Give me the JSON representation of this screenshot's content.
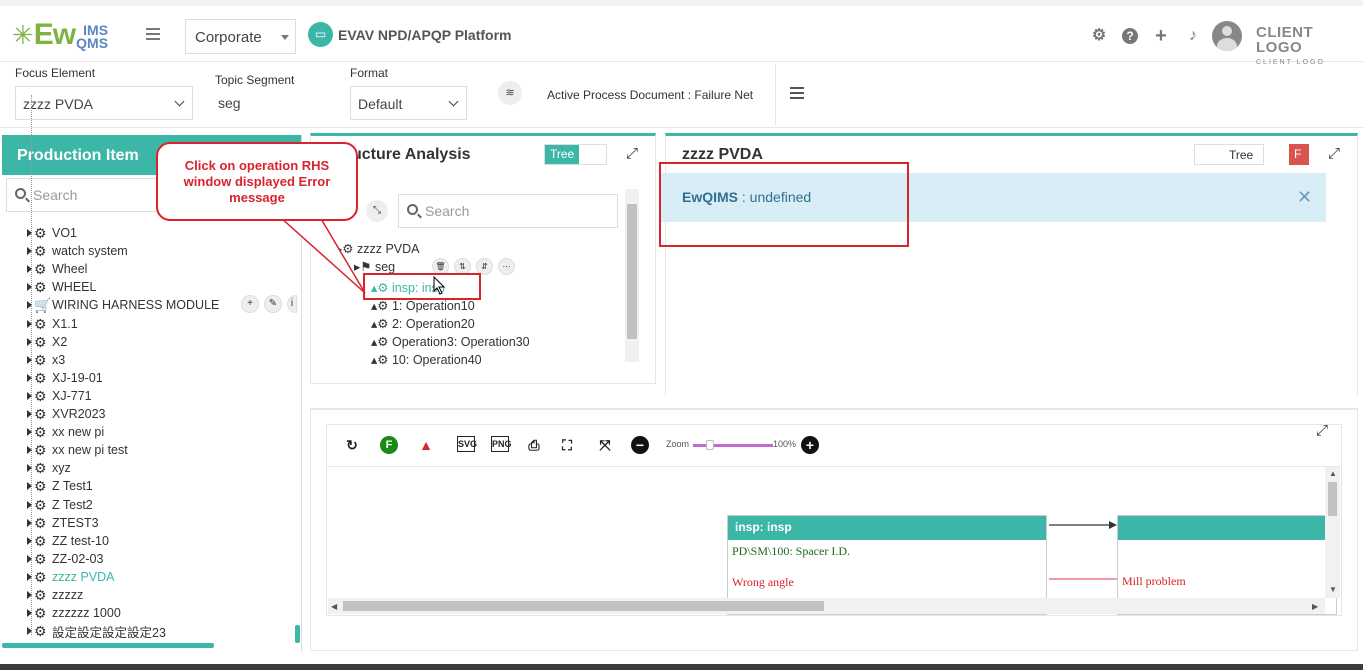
{
  "header": {
    "logo_main": "Ew",
    "logo_top": "IMS",
    "logo_bottom": "QMS",
    "corporate_select": "Corporate",
    "platform_title": "EVAV NPD/APQP Platform",
    "client_logo": "CLIENT LOGO",
    "client_logo_sub": "CLIENT LOGO"
  },
  "filters": {
    "focus_label": "Focus Element",
    "focus_value": "zzzz PVDA",
    "topic_label": "Topic Segment",
    "topic_value": "seg",
    "format_label": "Format",
    "format_value": "Default",
    "active_doc": "Active Process Document : Failure Net"
  },
  "left_panel": {
    "title": "Production Item",
    "search_placeholder": "Search",
    "items": [
      {
        "label": "VO1",
        "icon": "gear-icon"
      },
      {
        "label": "watch system",
        "icon": "gear-icon"
      },
      {
        "label": "Wheel",
        "icon": "gear-icon"
      },
      {
        "label": "WHEEL",
        "icon": "gear-icon"
      },
      {
        "label": "WIRING HARNESS MODULE",
        "icon": "cart-icon"
      },
      {
        "label": "X1.1",
        "icon": "gear-icon"
      },
      {
        "label": "X2",
        "icon": "gear-icon"
      },
      {
        "label": "x3",
        "icon": "gear-icon"
      },
      {
        "label": "XJ-19-01",
        "icon": "gear-icon"
      },
      {
        "label": "XJ-771",
        "icon": "gear-icon"
      },
      {
        "label": "XVR2023",
        "icon": "gear-icon"
      },
      {
        "label": "xx new pi",
        "icon": "gear-icon"
      },
      {
        "label": "xx new pi test",
        "icon": "gear-icon"
      },
      {
        "label": "xyz",
        "icon": "gear-icon"
      },
      {
        "label": "Z Test1",
        "icon": "gear-icon"
      },
      {
        "label": "Z Test2",
        "icon": "gear-icon"
      },
      {
        "label": "ZTEST3",
        "icon": "gear-icon"
      },
      {
        "label": "ZZ test-10",
        "icon": "gear-icon"
      },
      {
        "label": "ZZ-02-03",
        "icon": "gear-icon"
      },
      {
        "label": "zzzz PVDA",
        "icon": "gear-icon",
        "active": true
      },
      {
        "label": "zzzzz",
        "icon": "gear-icon"
      },
      {
        "label": "zzzzzz 1000",
        "icon": "gear-icon"
      },
      {
        "label": "設定設定設定設定23",
        "icon": "gear-icon"
      }
    ]
  },
  "callout": {
    "text": "Click on operation RHS window displayed Error message"
  },
  "structure": {
    "title": "Structure Analysis",
    "title_visible": "ucture Analysis",
    "toggle_label": "Tree",
    "search_placeholder": "Search",
    "nodes": {
      "root": "zzzz PVDA",
      "seg": "seg",
      "insp": "insp: insp",
      "op1": "1:   Operation10",
      "op2": "2:   Operation20",
      "op3": "Operation3:  Operation30",
      "op4": "10:   Operation40"
    }
  },
  "right_panel": {
    "title": "zzzz PVDA",
    "toggle_label": "Tree",
    "toggle_f": "F",
    "error_brand": "EwQIMS",
    "error_text": " : undefined"
  },
  "diagram": {
    "zoom_label": "Zoom",
    "zoom_value": "100%",
    "zoom_level": 0.15,
    "box1_title": "insp: insp",
    "box1_line1": "PD\\SM\\100: Spacer I.D.",
    "box1_line2": "Wrong angle",
    "box2_line": "Mill problem"
  },
  "colors": {
    "accent": "#3bb6a7",
    "error": "#d9232d",
    "alert_bg": "#d9edf7"
  }
}
